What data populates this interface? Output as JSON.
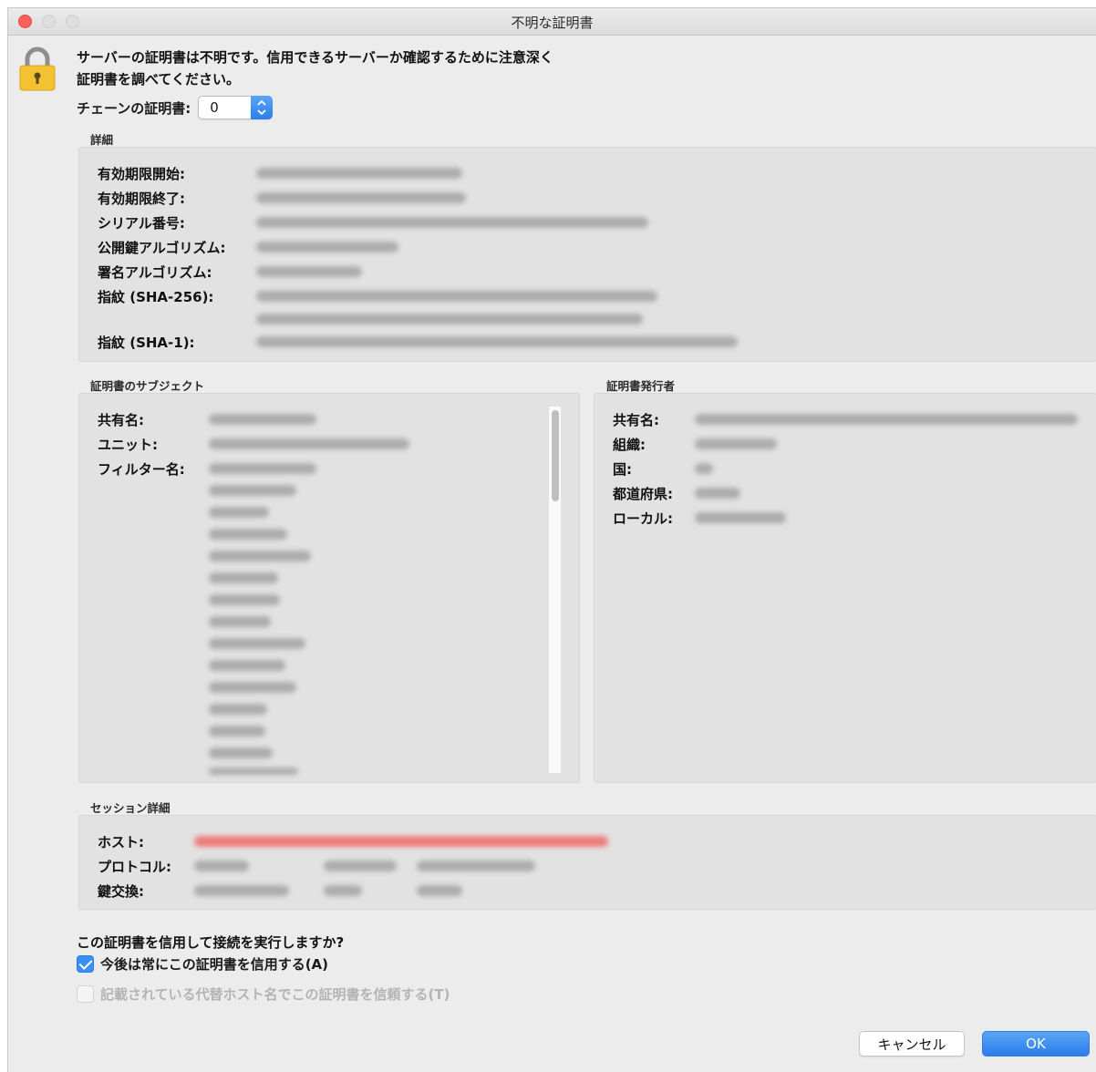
{
  "window": {
    "title": "不明な証明書"
  },
  "message": {
    "line1": "サーバーの証明書は不明です。信用できるサーバーか確認するために注意深く",
    "line2": "証明書を調べてください。"
  },
  "chain": {
    "label": "チェーンの証明書:",
    "value": "0"
  },
  "details": {
    "label": "詳細",
    "fields": {
      "valid_from": "有効期限開始:",
      "valid_to": "有効期限終了:",
      "serial": "シリアル番号:",
      "public_key_algorithm": "公開鍵アルゴリズム:",
      "signature_algorithm": "署名アルゴリズム:",
      "fingerprint_sha256": "指紋 (SHA-256):",
      "fingerprint_sha1": "指紋 (SHA-1):"
    }
  },
  "subject": {
    "label": "証明書のサブジェクト",
    "fields": {
      "common_name": "共有名:",
      "unit": "ユニット:",
      "filter_name": "フィルター名:"
    }
  },
  "issuer": {
    "label": "証明書発行者",
    "fields": {
      "common_name": "共有名:",
      "organization": "組織:",
      "country": "国:",
      "state": "都道府県:",
      "locality": "ローカル:"
    }
  },
  "session": {
    "label": "セッション詳細",
    "fields": {
      "host": "ホスト:",
      "protocol": "プロトコル:",
      "key_exchange": "鍵交換:"
    }
  },
  "trust": {
    "question": "この証明書を信用して接続を実行しますか?",
    "always_trust": "今後は常にこの証明書を信用する(A)",
    "trust_alt_hosts": "記載されている代替ホスト名でこの証明書を信頼する(T)"
  },
  "buttons": {
    "cancel": "キャンセル",
    "ok": "OK"
  },
  "colors": {
    "accent": "#2b7de9",
    "close": "#fc605c",
    "host_warning": "#f06a6a"
  }
}
